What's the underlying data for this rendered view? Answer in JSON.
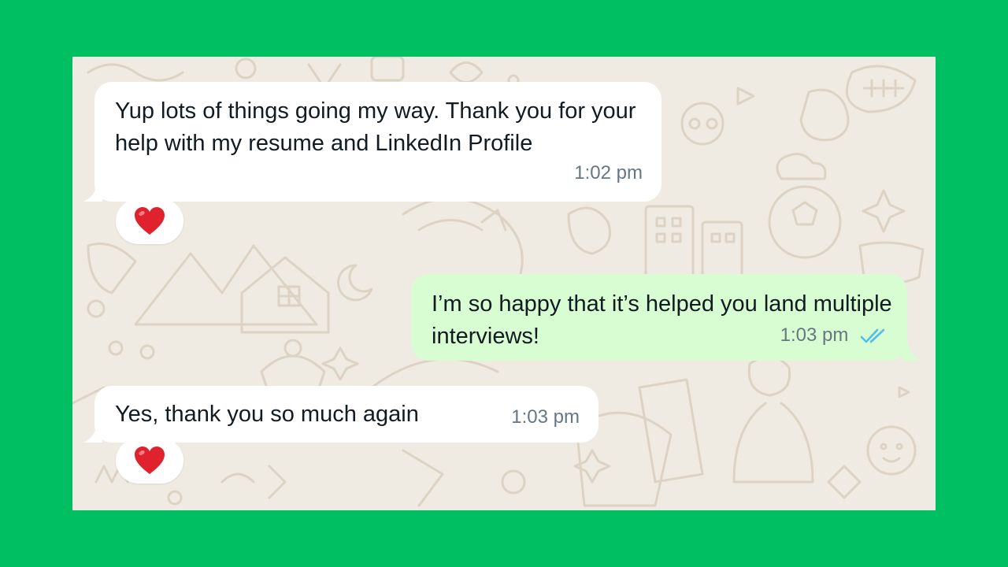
{
  "messages": [
    {
      "direction": "incoming",
      "text": "Yup lots of things going my way. Thank you for your help with my resume and LinkedIn Profile",
      "time": "1:02 pm",
      "reaction": "heart-emoji"
    },
    {
      "direction": "outgoing",
      "text": "I’m so happy that it’s helped you land multiple interviews!",
      "time": "1:03 pm",
      "status": "read-double-check"
    },
    {
      "direction": "incoming",
      "text": "Yes, thank you so much again",
      "time": "1:03 pm",
      "reaction": "heart-emoji"
    }
  ],
  "colors": {
    "frame": "#00bf63",
    "chat_background": "#efeae2",
    "incoming_bubble": "#ffffff",
    "outgoing_bubble": "#d9fdd3",
    "timestamp": "#667781",
    "read_ticks": "#53bdeb",
    "heart": "#e0222e"
  }
}
